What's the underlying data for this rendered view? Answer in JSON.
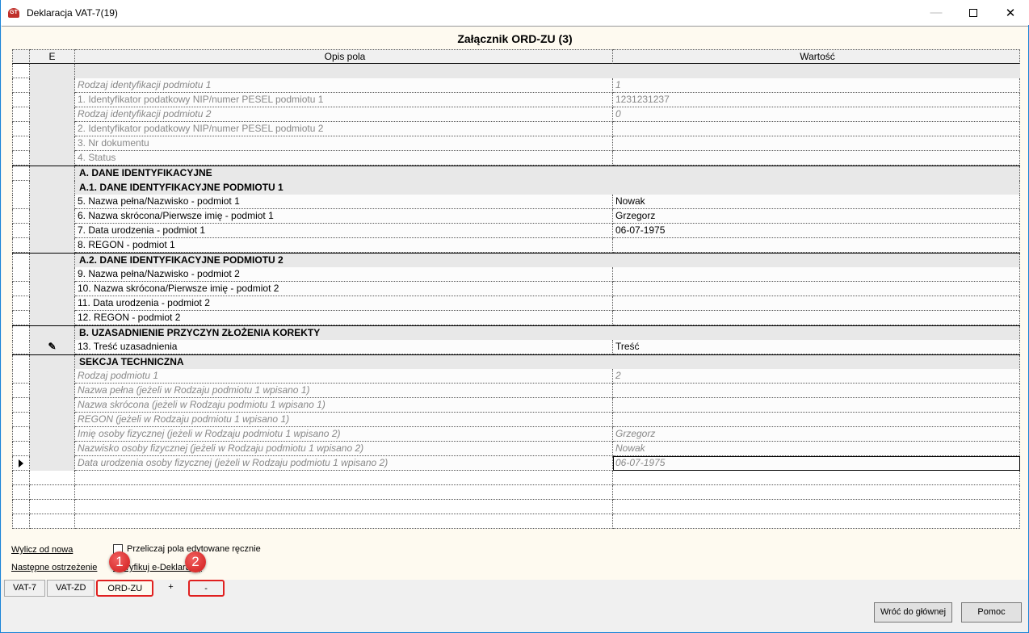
{
  "window": {
    "title": "Deklaracja VAT-7(19)",
    "icon_text": "GT"
  },
  "heading": "Załącznik ORD-ZU (3)",
  "columns": {
    "e": "E",
    "desc": "Opis pola",
    "value": "Wartość"
  },
  "rows": [
    {
      "type": "blank"
    },
    {
      "type": "field",
      "desc": "Rodzaj identyfikacji podmiotu 1",
      "value": "1",
      "style": "italic"
    },
    {
      "type": "field",
      "desc": "1. Identyfikator podatkowy NIP/numer PESEL podmiotu 1",
      "value": "1231231237",
      "style": "grey"
    },
    {
      "type": "field",
      "desc": "Rodzaj identyfikacji podmiotu 2",
      "value": "0",
      "style": "italic"
    },
    {
      "type": "field",
      "desc": "2. Identyfikator podatkowy NIP/numer PESEL podmiotu 2",
      "value": "",
      "style": "grey"
    },
    {
      "type": "field",
      "desc": "3. Nr dokumentu",
      "value": "",
      "style": "grey"
    },
    {
      "type": "field",
      "desc": "4. Status",
      "value": "",
      "style": "grey"
    },
    {
      "type": "section",
      "desc": "A. DANE IDENTYFIKACYJNE"
    },
    {
      "type": "section",
      "desc": "A.1. DANE IDENTYFIKACYJNE PODMIOTU 1"
    },
    {
      "type": "field",
      "desc": "5. Nazwa pełna/Nazwisko - podmiot 1",
      "value": "Nowak",
      "style": ""
    },
    {
      "type": "field",
      "desc": "6. Nazwa skrócona/Pierwsze imię - podmiot 1",
      "value": "Grzegorz",
      "style": ""
    },
    {
      "type": "field",
      "desc": "7. Data urodzenia - podmiot 1",
      "value": "06-07-1975",
      "style": ""
    },
    {
      "type": "field",
      "desc": "8. REGON - podmiot 1",
      "value": "",
      "style": ""
    },
    {
      "type": "section",
      "desc": "A.2. DANE IDENTYFIKACYJNE PODMIOTU 2"
    },
    {
      "type": "field",
      "desc": "9. Nazwa pełna/Nazwisko - podmiot 2",
      "value": "",
      "style": ""
    },
    {
      "type": "field",
      "desc": "10. Nazwa skrócona/Pierwsze imię - podmiot 2",
      "value": "",
      "style": ""
    },
    {
      "type": "field",
      "desc": "11. Data urodzenia - podmiot 2",
      "value": "",
      "style": ""
    },
    {
      "type": "field",
      "desc": "12. REGON - podmiot 2",
      "value": "",
      "style": ""
    },
    {
      "type": "section",
      "desc": "B. UZASADNIENIE PRZYCZYN ZŁOŻENIA KOREKTY"
    },
    {
      "type": "field",
      "desc": "13. Treść uzasadnienia",
      "value": "Treść",
      "style": "",
      "e_icon": "edit-pen-icon"
    },
    {
      "type": "section",
      "desc": "SEKCJA TECHNICZNA"
    },
    {
      "type": "field",
      "desc": "Rodzaj podmiotu 1",
      "value": "2",
      "style": "italic"
    },
    {
      "type": "field",
      "desc": "Nazwa pełna (jeżeli w Rodzaju podmiotu 1 wpisano 1)",
      "value": "",
      "style": "italic"
    },
    {
      "type": "field",
      "desc": "Nazwa skrócona (jeżeli w Rodzaju podmiotu 1 wpisano 1)",
      "value": "",
      "style": "italic"
    },
    {
      "type": "field",
      "desc": "REGON (jeżeli w Rodzaju podmiotu 1 wpisano 1)",
      "value": "",
      "style": "italic"
    },
    {
      "type": "field",
      "desc": "Imię osoby fizycznej (jeżeli w Rodzaju podmiotu 1 wpisano 2)",
      "value": "Grzegorz",
      "style": "italic"
    },
    {
      "type": "field",
      "desc": "Nazwisko osoby fizycznej (jeżeli w Rodzaju podmiotu 1 wpisano 2)",
      "value": "Nowak",
      "style": "italic"
    },
    {
      "type": "field",
      "desc": "Data urodzenia osoby fizycznej (jeżeli w Rodzaju podmiotu 1 wpisano 2)",
      "value": "06-07-1975",
      "style": "italic",
      "current": true
    },
    {
      "type": "empty"
    },
    {
      "type": "empty"
    },
    {
      "type": "empty"
    },
    {
      "type": "empty"
    }
  ],
  "links": {
    "recalc": "Wylicz od nowa",
    "next_warning": "Następne ostrzeżenie",
    "verify": "Weryfikuj e-Deklarację"
  },
  "checkbox": {
    "label": "Przeliczaj pola edytowane ręcznie",
    "checked": false
  },
  "tabs": [
    "VAT-7",
    "VAT-ZD",
    "ORD-ZU",
    "+",
    "-"
  ],
  "active_tab": "ORD-ZU",
  "badges": [
    "1",
    "2"
  ],
  "buttons": {
    "back": "Wróć do głównej",
    "help": "Pomoc"
  },
  "colors": {
    "highlight": "#e02020",
    "panel": "#fefaf0",
    "section": "#e8e8e8"
  }
}
